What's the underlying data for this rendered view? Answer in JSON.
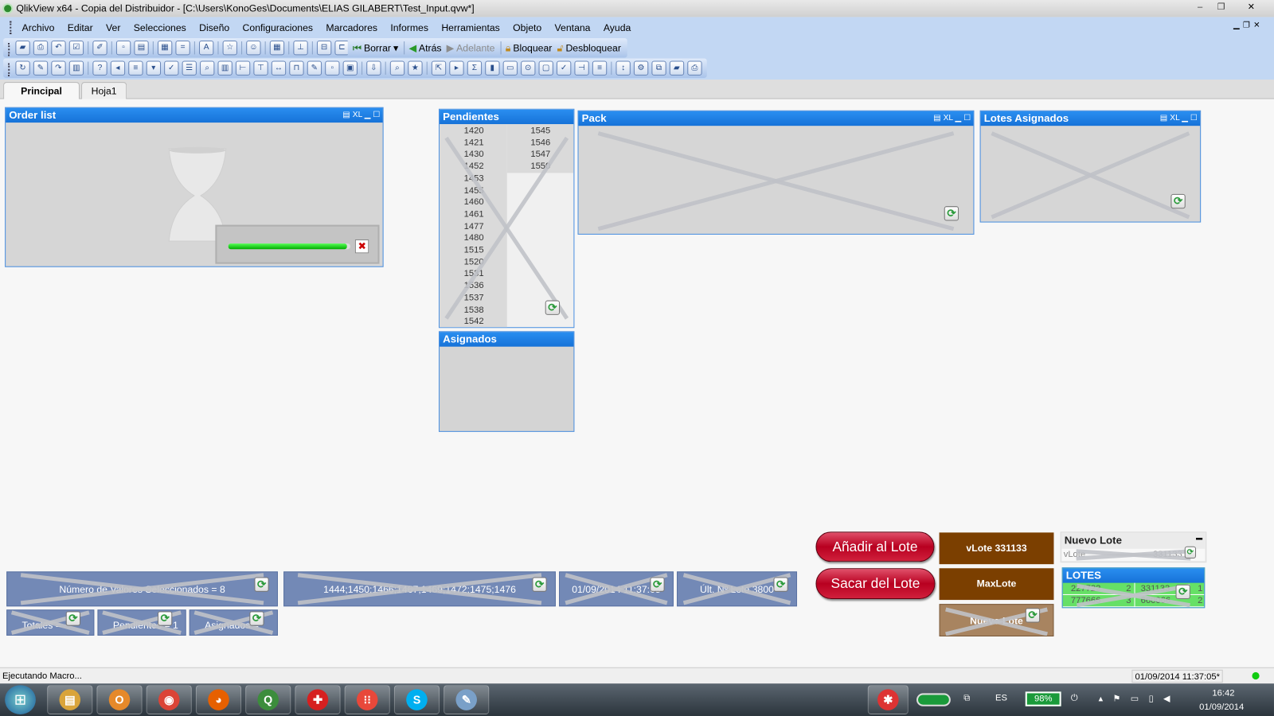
{
  "window": {
    "title": "QlikView x64 - Copia del Distribuidor - [C:\\Users\\KonoGes\\Documents\\ELIAS GILABERT\\Test_Input.qvw*]",
    "minimize": "–",
    "restore": "❐",
    "close": "✕"
  },
  "menu": [
    "Archivo",
    "Editar",
    "Ver",
    "Selecciones",
    "Diseño",
    "Configuraciones",
    "Marcadores",
    "Informes",
    "Herramientas",
    "Objeto",
    "Ventana",
    "Ayuda"
  ],
  "toolbar1": {
    "icons": [
      "new-icon",
      "open-icon",
      "reload-icon",
      "save-icon",
      "print-icon",
      "edit-script-icon",
      "reload-data-icon",
      "undo-icon",
      "redo-icon",
      "search-icon",
      "select-icon",
      "chart-wizard-icon",
      "favorite-icon",
      "edit-icon",
      "help-icon",
      "context-help-icon"
    ],
    "borrar": "Borrar",
    "atras": "Atrás",
    "adelante": "Adelante",
    "bloquear": "Bloquear",
    "desbloquear": "Desbloquear"
  },
  "toolbar2": {
    "icons": [
      "new-sheet-icon",
      "sheet-back-icon",
      "sheet-forward-icon",
      "sheet-properties-icon",
      "listbox-icon",
      "statistics-box-icon",
      "table-box-icon",
      "multibox-icon",
      "chart-icon",
      "input-box-icon",
      "current-selections-icon",
      "button-icon",
      "text-object-icon",
      "line-arrow-icon",
      "slider-icon",
      "bookmark-object-icon",
      "search-object-icon",
      "container-icon",
      "custom-object-icon",
      "chart-wizard-icon",
      "format-painter-icon",
      "grid-icon",
      "align-left-icon",
      "align-center-icon",
      "align-right-icon",
      "align-bottom-icon",
      "align-middle-icon",
      "align-top-icon",
      "space-horizontal-icon",
      "space-vertical-icon",
      "adjust-left-icon",
      "adjust-top-icon",
      "server-icon",
      "publish-icon",
      "document-edit-icon",
      "network-icon",
      "document-lock-icon"
    ]
  },
  "tabs": [
    "Principal",
    "Hoja1"
  ],
  "order_list": {
    "title": "Order list",
    "cap_icons": "▤ XL ▁ ☐",
    "progress": 0.97,
    "cancel": "✖"
  },
  "pendientes": {
    "title": "Pendientes",
    "col1": [
      "1420",
      "1421",
      "1430",
      "1452",
      "1453",
      "1455",
      "1460",
      "1461",
      "1477",
      "1480",
      "1515",
      "1520",
      "1531",
      "1536",
      "1537",
      "1538",
      "1542"
    ],
    "col2": [
      "1545",
      "1546",
      "1547",
      "1550"
    ]
  },
  "asignados": {
    "title": "Asignados"
  },
  "pack": {
    "title": "Pack",
    "cap_icons": "▤ XL ▁ ☐"
  },
  "lotes_asignados": {
    "title": "Lotes Asignados",
    "cap_icons": "▤ XL ▁ ☐"
  },
  "buttons": {
    "anadir": "Añadir al Lote",
    "sacar": "Sacar del Lote"
  },
  "brown_boxes": {
    "vlote": "vLote 331133",
    "maxlote": "MaxLote",
    "nuevo": "Nuevo Lote"
  },
  "nuevo_lote": {
    "title": "Nuevo Lote",
    "min": "▬",
    "label": "vLote",
    "value": "331133"
  },
  "lotes": {
    "title": "LOTES",
    "rows": [
      [
        "227722",
        "2",
        "331133",
        "1"
      ],
      [
        "777666",
        "3",
        "660066",
        "2"
      ]
    ]
  },
  "text_objects": [
    "Número de Valores Seleccionados = 8",
    "1444;1450;1466;1467;1469;1472;1475;1476",
    "01/09/2014 11:37:05",
    "Últ. Nº Lote 3800"
  ],
  "text_objects2": [
    "Totales = ",
    "Pendientes = 1",
    "Asignados = "
  ],
  "status": {
    "left": "Ejecutando Macro...",
    "datetime": "01/09/2014 11:37:05*"
  },
  "taskbar": {
    "apps": [
      {
        "name": "file-explorer-icon",
        "glyph": "▤",
        "color": "#d9a43a"
      },
      {
        "name": "outlook-icon",
        "glyph": "O",
        "color": "#e6892a"
      },
      {
        "name": "chrome-icon",
        "glyph": "◉",
        "color": "#db4437"
      },
      {
        "name": "firefox-icon",
        "glyph": "◕",
        "color": "#e66000"
      },
      {
        "name": "qlikview-icon",
        "glyph": "Q",
        "color": "#3c8d3c"
      },
      {
        "name": "lifesaver-icon",
        "glyph": "✚",
        "color": "#d62020"
      },
      {
        "name": "apps-grid-icon",
        "glyph": "⁝⁝",
        "color": "#e8483a"
      },
      {
        "name": "skype-icon",
        "glyph": "S",
        "color": "#00aff0"
      },
      {
        "name": "paint-icon",
        "glyph": "✎",
        "color": "#7aa0c8"
      }
    ],
    "lang": "ES",
    "battery": "98%",
    "time": "16:42",
    "date": "01/09/2014"
  },
  "colors": {
    "caption": "#1e7be0",
    "textobj": "#7389b6",
    "brown": "#7b3f00",
    "red": "#c0102c",
    "green": "#66e066"
  }
}
